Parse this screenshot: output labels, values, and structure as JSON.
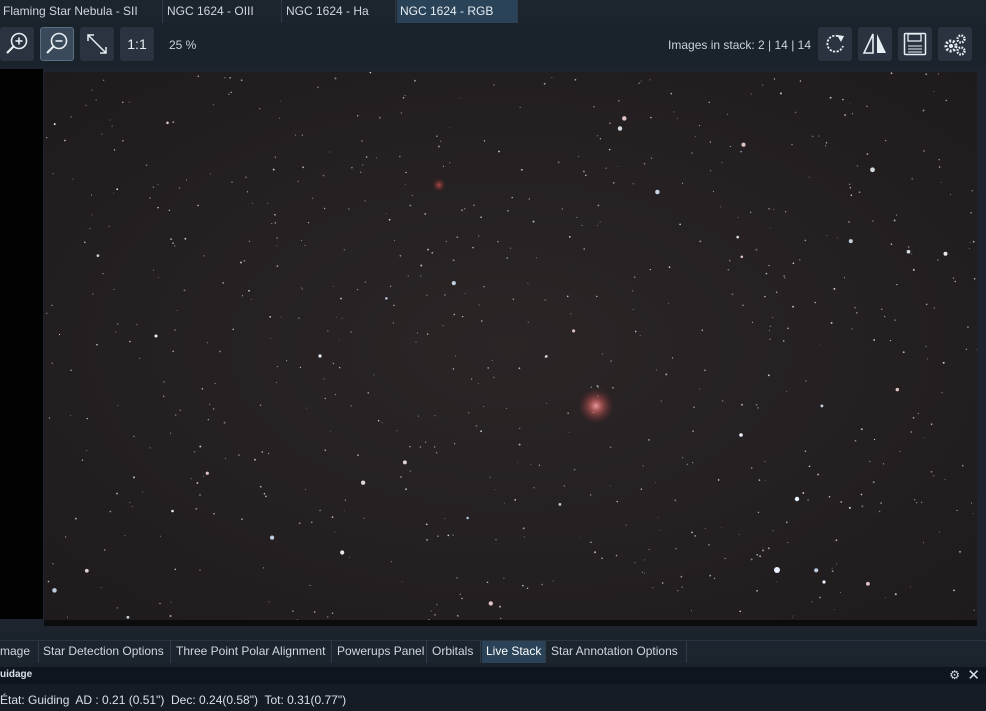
{
  "top_tabs": [
    {
      "label": "Flaming Star Nebula - SII",
      "active": false
    },
    {
      "label": "NGC 1624 - OIII",
      "active": false
    },
    {
      "label": "NGC 1624 - Ha",
      "active": false
    },
    {
      "label": "NGC 1624 - RGB",
      "active": true
    }
  ],
  "toolbar": {
    "zoom_in_icon": "zoom-in-icon",
    "zoom_out_icon": "zoom-out-icon",
    "fit_icon": "fit-to-window-icon",
    "one_to_one_label": "1:1",
    "zoom_level": "25 %",
    "stack_info": "Images in stack: 2 | 14 | 14",
    "refresh_icon": "refresh-icon",
    "flip_icon": "flip-horizontal-icon",
    "save_icon": "save-icon",
    "settings_icon": "settings-gears-icon"
  },
  "bottom_tabs": [
    {
      "label": "mage",
      "active": false
    },
    {
      "label": "Star Detection Options",
      "active": false
    },
    {
      "label": "Three Point Polar Alignment",
      "active": false
    },
    {
      "label": "Powerups Panel",
      "active": false
    },
    {
      "label": "Orbitals",
      "active": false
    },
    {
      "label": "Live Stack",
      "active": true
    },
    {
      "label": "Star Annotation Options",
      "active": false
    }
  ],
  "guiding": {
    "title": "uidage",
    "status": "État: Guiding  AD : 0.21 (0.51\")  Dec: 0.24(0.58\")  Tot: 0.31(0.77\")"
  },
  "colors": {
    "background": "#1a222c",
    "active_tab": "#2b4358",
    "sky": "#241f21"
  }
}
